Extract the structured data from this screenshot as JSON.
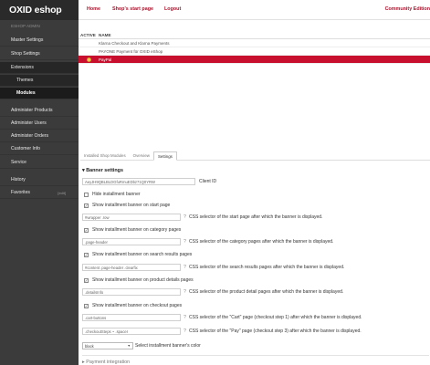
{
  "logo": "OXID eshop",
  "sidebar": {
    "admin_label": "ESHOP ADMIN",
    "items": [
      {
        "label": "Master Settings"
      },
      {
        "label": "Shop Settings"
      },
      {
        "label": "Extensions"
      },
      {
        "label": "Themes"
      },
      {
        "label": "Modules"
      },
      {
        "label": "Administer Products"
      },
      {
        "label": "Administer Users"
      },
      {
        "label": "Administer Orders"
      },
      {
        "label": "Customer Info"
      },
      {
        "label": "Service"
      },
      {
        "label": "History"
      },
      {
        "label": "Favorites",
        "count": "[edit]"
      }
    ]
  },
  "topnav": {
    "home": "Home",
    "start_page": "Shop's start page",
    "logout": "Logout",
    "edition": "Community Edition"
  },
  "list": {
    "col_active": "ACTIVE",
    "col_name": "NAME",
    "rows": [
      {
        "name": "Klarna Checkout and Klarna Payments",
        "active": false,
        "selected": false
      },
      {
        "name": "PAYONE Payment für OXID eShop",
        "active": false,
        "selected": false
      },
      {
        "name": "PayPal",
        "active": true,
        "selected": true
      }
    ]
  },
  "tabs": [
    "Installed Shop Modules",
    "Overview",
    "Settings"
  ],
  "banner": {
    "title": "Banner settings",
    "client_id_value": "AeyJH9QBLBLDGfuRmuEDbz71Q0YRW",
    "client_id_label": "Client ID",
    "hide_label": "Hide installment banner",
    "start_check": "Show installment banner on start page",
    "start_value": "#wrapper .row",
    "start_desc": "CSS selector of the start page after which the banner is displayed.",
    "category_check": "Show installment banner on category pages",
    "category_value": ".page-header",
    "category_desc": "CSS selector of the category pages after which the banner is displayed.",
    "search_check": "Show installment banner on search results pages",
    "search_value": "#content .page-header .clearfix",
    "search_desc": "CSS selector of the search results pages after which the banner is displayed.",
    "product_check": "Show installment banner on product details pages",
    "product_value": ".detailsInfo",
    "product_desc": "CSS selector of the product detail pages after which the banner is displayed.",
    "checkout_check": "Show installment banner on checkout pages",
    "cart_value": ".cart-buttons",
    "cart_desc": "CSS selector of the \"Cart\" page (checkout step 1) after which the banner is displayed.",
    "pay_value": ".checkoutSteps ~ .spacer",
    "pay_desc": "CSS selector of the \"Pay\" page (checkout step 3) after which the banner is displayed.",
    "color_value": "black",
    "color_label": "Select installment banner's color",
    "next_section": "Payment integration"
  },
  "qicon": "?"
}
